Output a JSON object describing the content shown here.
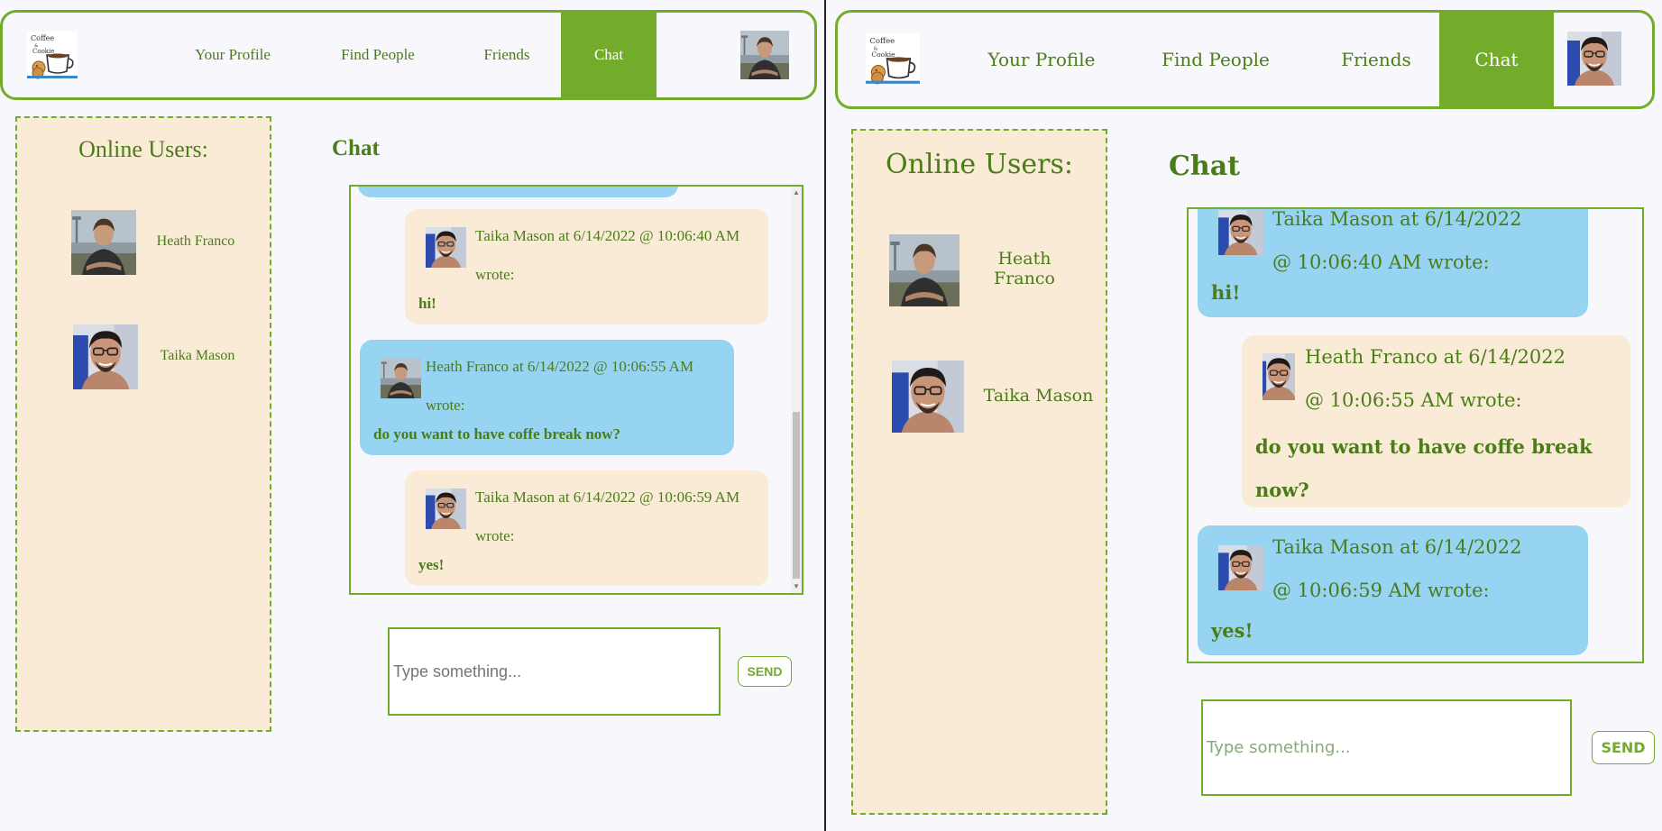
{
  "nav": {
    "logo_text": "Coffee & Cookie",
    "links": [
      "Your Profile",
      "Find People",
      "Friends",
      "Chat"
    ],
    "active": "Chat"
  },
  "online": {
    "title": "Online Users:",
    "users": [
      "Heath Franco",
      "Taika Mason"
    ]
  },
  "chat": {
    "title": "Chat",
    "messages": [
      {
        "meta": "Taika Mason at 6/14/2022 @ 10:06:40 AM wrote:",
        "text": "hi!"
      },
      {
        "meta": "Heath Franco at 6/14/2022 @ 10:06:55 AM wrote:",
        "text": "do you want to have coffe break now?"
      },
      {
        "meta": "Taika Mason at 6/14/2022 @ 10:06:59 AM wrote:",
        "text": "yes!"
      }
    ],
    "input_placeholder": "Type something...",
    "send_label": "SEND"
  },
  "colors": {
    "accent": "#72ac2a",
    "text_green": "#4a7c18",
    "beige": "#faebd7",
    "bubble_blue": "#97d4f2",
    "background": "#f8f8fc"
  },
  "icons": {
    "logo": "coffee-cup-logo",
    "avatar_heath": "person-portrait-arms-crossed",
    "avatar_taika": "person-portrait-glasses"
  }
}
